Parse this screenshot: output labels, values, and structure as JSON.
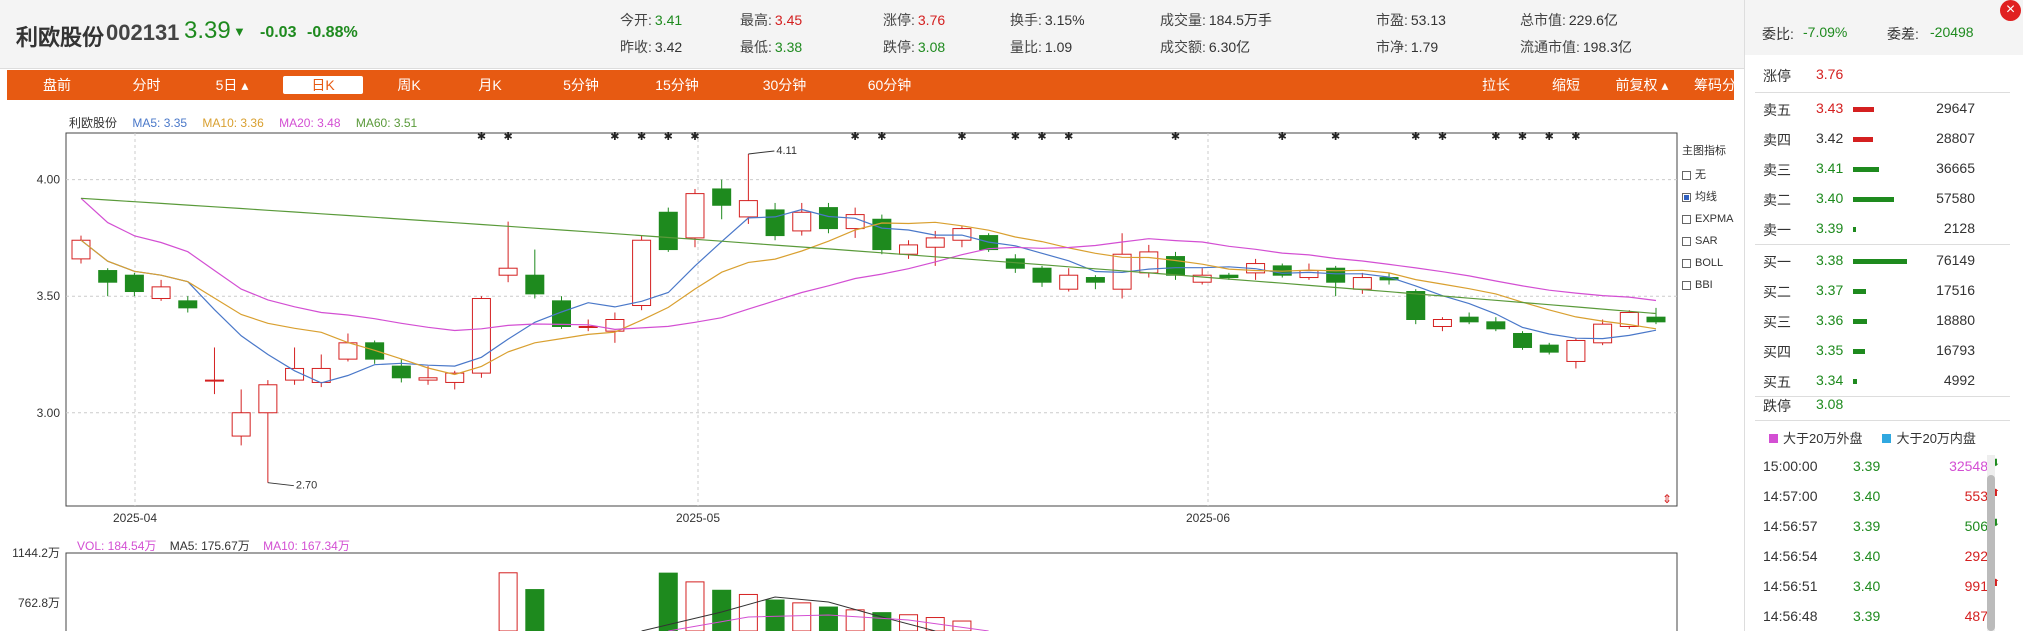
{
  "header": {
    "name": "利欧股份",
    "code": "002131",
    "price": "3.39",
    "arrow": "▼",
    "change": "-0.03",
    "pct": "-0.88%",
    "quotes": [
      {
        "label": "今开:",
        "value": "3.41",
        "color": "green"
      },
      {
        "label": "最高:",
        "value": "3.45",
        "color": "red"
      },
      {
        "label": "涨停:",
        "value": "3.76",
        "color": "red"
      },
      {
        "label": "换手:",
        "value": "3.15%",
        "color": "dark"
      },
      {
        "label": "成交量:",
        "value": "184.5万手",
        "color": "dark"
      },
      {
        "label": "市盈:",
        "value": "53.13",
        "color": "dark"
      },
      {
        "label": "总市值:",
        "value": "229.6亿",
        "color": "dark"
      },
      {
        "label": "昨收:",
        "value": "3.42",
        "color": "dark"
      },
      {
        "label": "最低:",
        "value": "3.38",
        "color": "green"
      },
      {
        "label": "跌停:",
        "value": "3.08",
        "color": "green"
      },
      {
        "label": "量比:",
        "value": "1.09",
        "color": "dark"
      },
      {
        "label": "成交额:",
        "value": "6.30亿",
        "color": "dark"
      },
      {
        "label": "市净:",
        "value": "1.79",
        "color": "dark"
      },
      {
        "label": "流通市值:",
        "value": "198.3亿",
        "color": "dark"
      }
    ]
  },
  "nav": {
    "tabs": [
      "盘前",
      "分时",
      "5日 ▴",
      "日K",
      "周K",
      "月K",
      "5分钟",
      "15分钟",
      "30分钟",
      "60分钟"
    ],
    "active": "日K",
    "right": [
      "拉长",
      "缩短",
      "前复权 ▴",
      "筹码分布"
    ]
  },
  "legend": {
    "name": "利欧股份",
    "ma5": "MA5: 3.35",
    "ma10": "MA10: 3.36",
    "ma20": "MA20: 3.48",
    "ma60": "MA60: 3.51"
  },
  "vol_legend": {
    "vol": "VOL: 184.54万",
    "ma5": "MA5: 175.67万",
    "ma10": "MA10: 167.34万"
  },
  "indicators": {
    "title": "主图指标",
    "items": [
      "无",
      "均线",
      "EXPMA",
      "SAR",
      "BOLL",
      "BBI"
    ],
    "checked": "均线"
  },
  "colors": {
    "up": "#d42020",
    "down": "#1e8a1e",
    "ma5": "#4a78c9",
    "ma10": "#d9a030",
    "ma20": "#d34fd3",
    "ma60": "#5a9a3a",
    "accent": "#e75a12"
  },
  "chart_data": {
    "type": "candlestick",
    "y_ticks": [
      "4.00",
      "3.50",
      "3.00"
    ],
    "ylim": [
      2.6,
      4.2
    ],
    "x_labels": [
      "2025-04",
      "2025-05",
      "2025-06"
    ],
    "annotations": [
      "4.11",
      "2.70"
    ],
    "vol_ticks": [
      "1144.2万",
      "762.8万"
    ],
    "candles": [
      [
        3.66,
        3.74,
        3.64,
        3.76
      ],
      [
        3.61,
        3.56,
        3.5,
        3.62
      ],
      [
        3.59,
        3.52,
        3.5,
        3.6
      ],
      [
        3.49,
        3.54,
        3.48,
        3.57
      ],
      [
        3.48,
        3.45,
        3.43,
        3.5
      ],
      [
        3.14,
        3.14,
        3.08,
        3.28
      ],
      [
        2.9,
        3.0,
        2.86,
        3.1
      ],
      [
        3.0,
        3.12,
        2.7,
        3.14
      ],
      [
        3.14,
        3.19,
        3.12,
        3.28
      ],
      [
        3.13,
        3.19,
        3.11,
        3.25
      ],
      [
        3.23,
        3.3,
        3.22,
        3.34
      ],
      [
        3.3,
        3.23,
        3.21,
        3.31
      ],
      [
        3.2,
        3.15,
        3.13,
        3.23
      ],
      [
        3.14,
        3.15,
        3.12,
        3.2
      ],
      [
        3.13,
        3.17,
        3.1,
        3.18
      ],
      [
        3.17,
        3.49,
        3.15,
        3.5
      ],
      [
        3.59,
        3.62,
        3.56,
        3.82
      ],
      [
        3.59,
        3.51,
        3.49,
        3.7
      ],
      [
        3.48,
        3.37,
        3.36,
        3.5
      ],
      [
        3.37,
        3.37,
        3.35,
        3.4
      ],
      [
        3.35,
        3.4,
        3.3,
        3.43
      ],
      [
        3.46,
        3.74,
        3.44,
        3.76
      ],
      [
        3.86,
        3.7,
        3.69,
        3.88
      ],
      [
        3.75,
        3.94,
        3.71,
        3.96
      ],
      [
        3.96,
        3.89,
        3.83,
        4.0
      ],
      [
        3.84,
        3.91,
        3.81,
        4.11
      ],
      [
        3.87,
        3.76,
        3.74,
        3.9
      ],
      [
        3.78,
        3.86,
        3.76,
        3.9
      ],
      [
        3.88,
        3.79,
        3.77,
        3.9
      ],
      [
        3.79,
        3.85,
        3.75,
        3.88
      ],
      [
        3.83,
        3.7,
        3.68,
        3.85
      ],
      [
        3.68,
        3.72,
        3.66,
        3.74
      ],
      [
        3.71,
        3.75,
        3.63,
        3.78
      ],
      [
        3.74,
        3.79,
        3.71,
        3.8
      ],
      [
        3.76,
        3.7,
        3.69,
        3.77
      ],
      [
        3.66,
        3.62,
        3.6,
        3.68
      ],
      [
        3.62,
        3.56,
        3.54,
        3.63
      ],
      [
        3.53,
        3.59,
        3.52,
        3.62
      ],
      [
        3.58,
        3.56,
        3.53,
        3.59
      ],
      [
        3.53,
        3.68,
        3.49,
        3.77
      ],
      [
        3.6,
        3.69,
        3.58,
        3.72
      ],
      [
        3.67,
        3.59,
        3.57,
        3.69
      ],
      [
        3.56,
        3.59,
        3.55,
        3.62
      ],
      [
        3.59,
        3.58,
        3.57,
        3.6
      ],
      [
        3.6,
        3.64,
        3.57,
        3.66
      ],
      [
        3.63,
        3.59,
        3.58,
        3.64
      ],
      [
        3.58,
        3.61,
        3.57,
        3.64
      ],
      [
        3.62,
        3.56,
        3.5,
        3.63
      ],
      [
        3.53,
        3.58,
        3.51,
        3.6
      ],
      [
        3.58,
        3.57,
        3.55,
        3.6
      ],
      [
        3.52,
        3.4,
        3.38,
        3.53
      ],
      [
        3.37,
        3.4,
        3.35,
        3.41
      ],
      [
        3.41,
        3.39,
        3.38,
        3.43
      ],
      [
        3.39,
        3.36,
        3.35,
        3.41
      ],
      [
        3.34,
        3.28,
        3.27,
        3.35
      ],
      [
        3.29,
        3.26,
        3.25,
        3.3
      ],
      [
        3.22,
        3.31,
        3.19,
        3.32
      ],
      [
        3.3,
        3.38,
        3.29,
        3.4
      ],
      [
        3.37,
        3.43,
        3.36,
        3.44
      ],
      [
        3.41,
        3.39,
        3.38,
        3.45
      ]
    ],
    "volumes": [
      0,
      0,
      0,
      0,
      0,
      0,
      0,
      0,
      0,
      0,
      0,
      0,
      0,
      0,
      0,
      0,
      1090,
      850,
      0,
      0,
      0,
      0,
      1085,
      960,
      840,
      780,
      700,
      660,
      600,
      560,
      520,
      490,
      450,
      400,
      0,
      0,
      0,
      0,
      0,
      0,
      0,
      0,
      0,
      0,
      0,
      0,
      0,
      0,
      0,
      0,
      0,
      0,
      0,
      0,
      0,
      0,
      0,
      0,
      0,
      0
    ]
  },
  "right_panel": {
    "weibi_label": "委比:",
    "weibi": "-7.09%",
    "weicha_label": "委差:",
    "weicha": "-20498",
    "zhangting_label": "涨停",
    "zhangting": "3.76",
    "asks": [
      {
        "label": "卖五",
        "price": "3.43",
        "vol": "29647",
        "pct": 0.28
      },
      {
        "label": "卖四",
        "price": "3.42",
        "vol": "28807",
        "pct": 0.27
      },
      {
        "label": "卖三",
        "price": "3.41",
        "vol": "36665",
        "pct": 0.35
      },
      {
        "label": "卖二",
        "price": "3.40",
        "vol": "57580",
        "pct": 0.55
      },
      {
        "label": "卖一",
        "price": "3.39",
        "vol": "2128",
        "pct": 0.02
      }
    ],
    "bids": [
      {
        "label": "买一",
        "price": "3.38",
        "vol": "76149",
        "pct": 0.72
      },
      {
        "label": "买二",
        "price": "3.37",
        "vol": "17516",
        "pct": 0.17
      },
      {
        "label": "买三",
        "price": "3.36",
        "vol": "18880",
        "pct": 0.18
      },
      {
        "label": "买四",
        "price": "3.35",
        "vol": "16793",
        "pct": 0.16
      },
      {
        "label": "买五",
        "price": "3.34",
        "vol": "4992",
        "pct": 0.05
      }
    ],
    "dieting_label": "跌停",
    "dieting": "3.08",
    "legend_out": "大于20万外盘",
    "legend_in": "大于20万内盘",
    "ticks": [
      {
        "time": "15:00:00",
        "price": "3.39",
        "vol": "32548",
        "dir": "⬇"
      },
      {
        "time": "14:57:00",
        "price": "3.40",
        "vol": "553",
        "dir": "⬆"
      },
      {
        "time": "14:56:57",
        "price": "3.39",
        "vol": "506",
        "dir": "⬇"
      },
      {
        "time": "14:56:54",
        "price": "3.40",
        "vol": "292",
        "dir": ""
      },
      {
        "time": "14:56:51",
        "price": "3.40",
        "vol": "991",
        "dir": "⬆"
      },
      {
        "time": "14:56:48",
        "price": "3.39",
        "vol": "487",
        "dir": ""
      }
    ]
  }
}
